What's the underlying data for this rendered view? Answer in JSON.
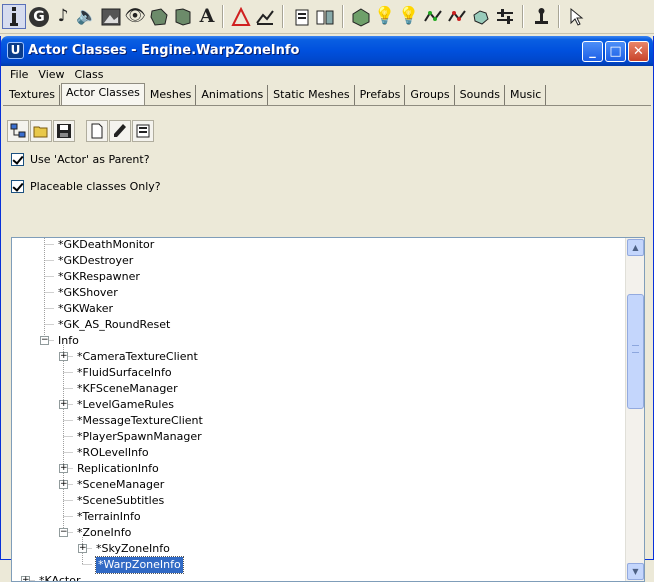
{
  "toolbar": {
    "icons": [
      "info-icon",
      "geometry-icon",
      "music-note-icon",
      "sound-icon",
      "texture-icon",
      "eye-icon",
      "mesh-icon",
      "mesh-alt-icon",
      "font-icon",
      "triangle-icon",
      "terrain-icon",
      "properties-icon",
      "group-icon",
      "actor-icon",
      "light-icon",
      "light-alt-icon",
      "path-icon",
      "path-alt-icon",
      "sound-alt-icon",
      "sliders-icon",
      "pawn-icon",
      "select-cursor-icon"
    ],
    "font_letter": "A",
    "geometry_letter": "G"
  },
  "window": {
    "title": "Actor Classes - Engine.WarpZoneInfo",
    "app_letter": "U",
    "min_glyph": "_",
    "max_glyph": "□",
    "close_glyph": "✕"
  },
  "menu": [
    "File",
    "View",
    "Class"
  ],
  "tabs": [
    {
      "label": "Textures",
      "active": false
    },
    {
      "label": "Actor Classes",
      "active": true
    },
    {
      "label": "Meshes",
      "active": false
    },
    {
      "label": "Animations",
      "active": false
    },
    {
      "label": "Static Meshes",
      "active": false
    },
    {
      "label": "Prefabs",
      "active": false
    },
    {
      "label": "Groups",
      "active": false
    },
    {
      "label": "Sounds",
      "active": false
    },
    {
      "label": "Music",
      "active": false
    }
  ],
  "tools": [
    "tree-view-icon",
    "open-folder-icon",
    "save-icon",
    "new-document-icon",
    "edit-pencil-icon",
    "properties-icon"
  ],
  "options": {
    "use_actor_parent": "Use 'Actor' as Parent?",
    "placeable_only": "Placeable classes Only?"
  },
  "tree": [
    {
      "label": "*GKDeathMonitor",
      "level": 1,
      "expander": "none"
    },
    {
      "label": "*GKDestroyer",
      "level": 1,
      "expander": "none"
    },
    {
      "label": "*GKRespawner",
      "level": 1,
      "expander": "none"
    },
    {
      "label": "*GKShover",
      "level": 1,
      "expander": "none"
    },
    {
      "label": "*GKWaker",
      "level": 1,
      "expander": "none"
    },
    {
      "label": "*GK_AS_RoundReset",
      "level": 1,
      "expander": "none"
    },
    {
      "label": "Info",
      "level": 1,
      "expander": "minus"
    },
    {
      "label": "*CameraTextureClient",
      "level": 2,
      "expander": "plus"
    },
    {
      "label": "*FluidSurfaceInfo",
      "level": 2,
      "expander": "none"
    },
    {
      "label": "*KFSceneManager",
      "level": 2,
      "expander": "none"
    },
    {
      "label": "*LevelGameRules",
      "level": 2,
      "expander": "plus"
    },
    {
      "label": "*MessageTextureClient",
      "level": 2,
      "expander": "none"
    },
    {
      "label": "*PlayerSpawnManager",
      "level": 2,
      "expander": "none"
    },
    {
      "label": "*ROLevelInfo",
      "level": 2,
      "expander": "none"
    },
    {
      "label": "ReplicationInfo",
      "level": 2,
      "expander": "plus"
    },
    {
      "label": "*SceneManager",
      "level": 2,
      "expander": "plus"
    },
    {
      "label": "*SceneSubtitles",
      "level": 2,
      "expander": "none"
    },
    {
      "label": "*TerrainInfo",
      "level": 2,
      "expander": "none"
    },
    {
      "label": "*ZoneInfo",
      "level": 2,
      "expander": "minus"
    },
    {
      "label": "*SkyZoneInfo",
      "level": 3,
      "expander": "plus"
    },
    {
      "label": "*WarpZoneInfo",
      "level": 3,
      "expander": "none",
      "selected": true
    },
    {
      "label": "*KActor",
      "level": 0,
      "expander": "plus"
    }
  ],
  "scrollbar": {
    "up_glyph": "▲",
    "down_glyph": "▼"
  }
}
